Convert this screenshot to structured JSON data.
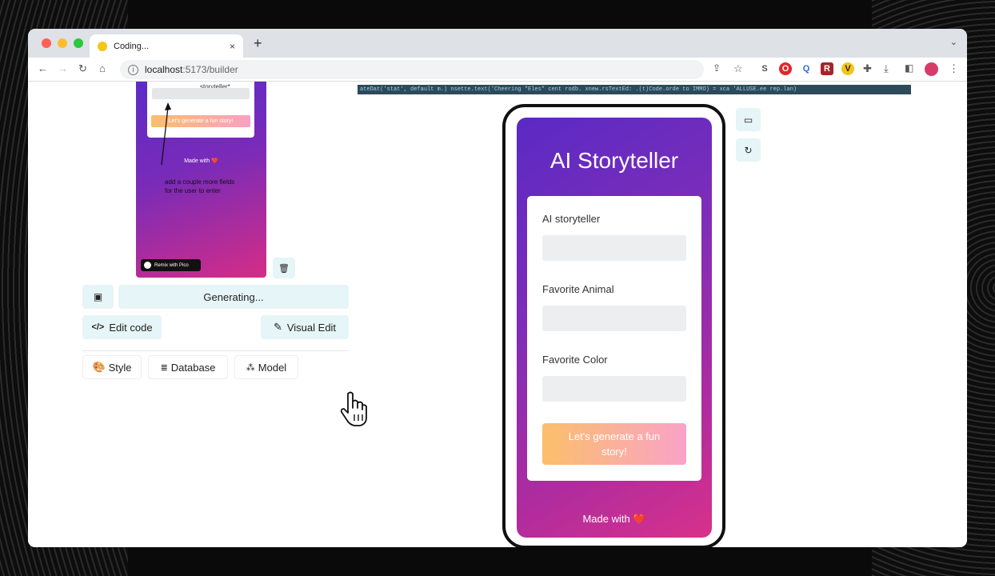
{
  "browser": {
    "tab_title": "Coding...",
    "tab_close": "×",
    "new_tab": "+",
    "address_host": "localhost",
    "address_path": ":5173/builder",
    "extensions": [
      "S",
      "O",
      "Q",
      "R",
      "V"
    ]
  },
  "preview": {
    "story_label": "storyteller*",
    "button_label": "Let's generate a fun story!",
    "made_with": "Made with ❤️",
    "annotation": "add a couple more fields for the user to enter",
    "remix_label": "Remix with Pico"
  },
  "left_panel": {
    "status_label": "Generating...",
    "edit_code_label": "Edit code",
    "visual_edit_label": "Visual Edit",
    "style_label": "Style",
    "database_label": "Database",
    "model_label": "Model"
  },
  "code_strip": "ateDat('stat', default m.) nsette.text('Cheering \"Eles\" cent rodb. xnew.rsTextEd: .(t)Code.orde to IMMO) = xca 'ALLUSE.ee rep.lan)",
  "app": {
    "title": "AI Storyteller",
    "fields": [
      {
        "label": "AI storyteller"
      },
      {
        "label": "Favorite Animal"
      },
      {
        "label": "Favorite Color"
      }
    ],
    "generate_button": "Let's generate a fun story!",
    "made_with": "Made with ❤️"
  },
  "colors": {
    "accent_soft": "#e6f5f7",
    "gradient_start": "#5a2ac4",
    "gradient_end": "#d8318a",
    "button_gradient_start": "#fbbf6b",
    "button_gradient_end": "#f9a3c8"
  }
}
